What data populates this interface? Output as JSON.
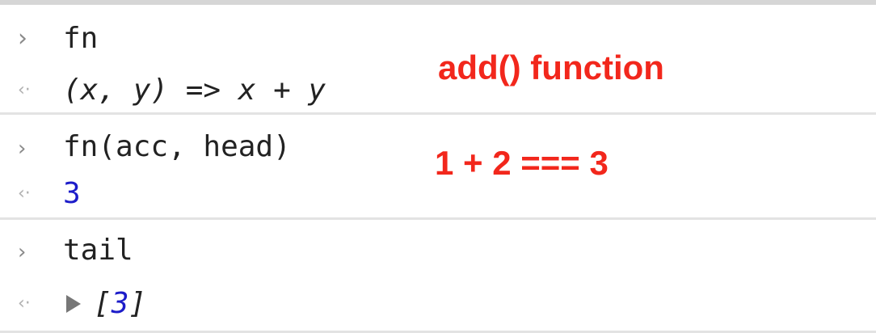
{
  "console": {
    "entries": [
      {
        "input": "fn",
        "output": "(x, y) => x + y"
      },
      {
        "input": "fn(acc, head)",
        "output": "3"
      },
      {
        "input": "tail",
        "output_open": "[",
        "output_value": "3",
        "output_close": "]"
      }
    ],
    "prompt_input_glyph": "›",
    "prompt_output_glyph": "‹·"
  },
  "annotations": {
    "first": "add() function",
    "second": "1 + 2 === 3"
  },
  "colors": {
    "annotation": "#f2271c",
    "number": "#1c1cc9",
    "prompt": "#8a8a8a",
    "text": "#222222"
  },
  "icons": {
    "input_prompt": "chevron-right-icon",
    "output_prompt": "result-arrow-icon",
    "expand": "triangle-right-icon"
  }
}
